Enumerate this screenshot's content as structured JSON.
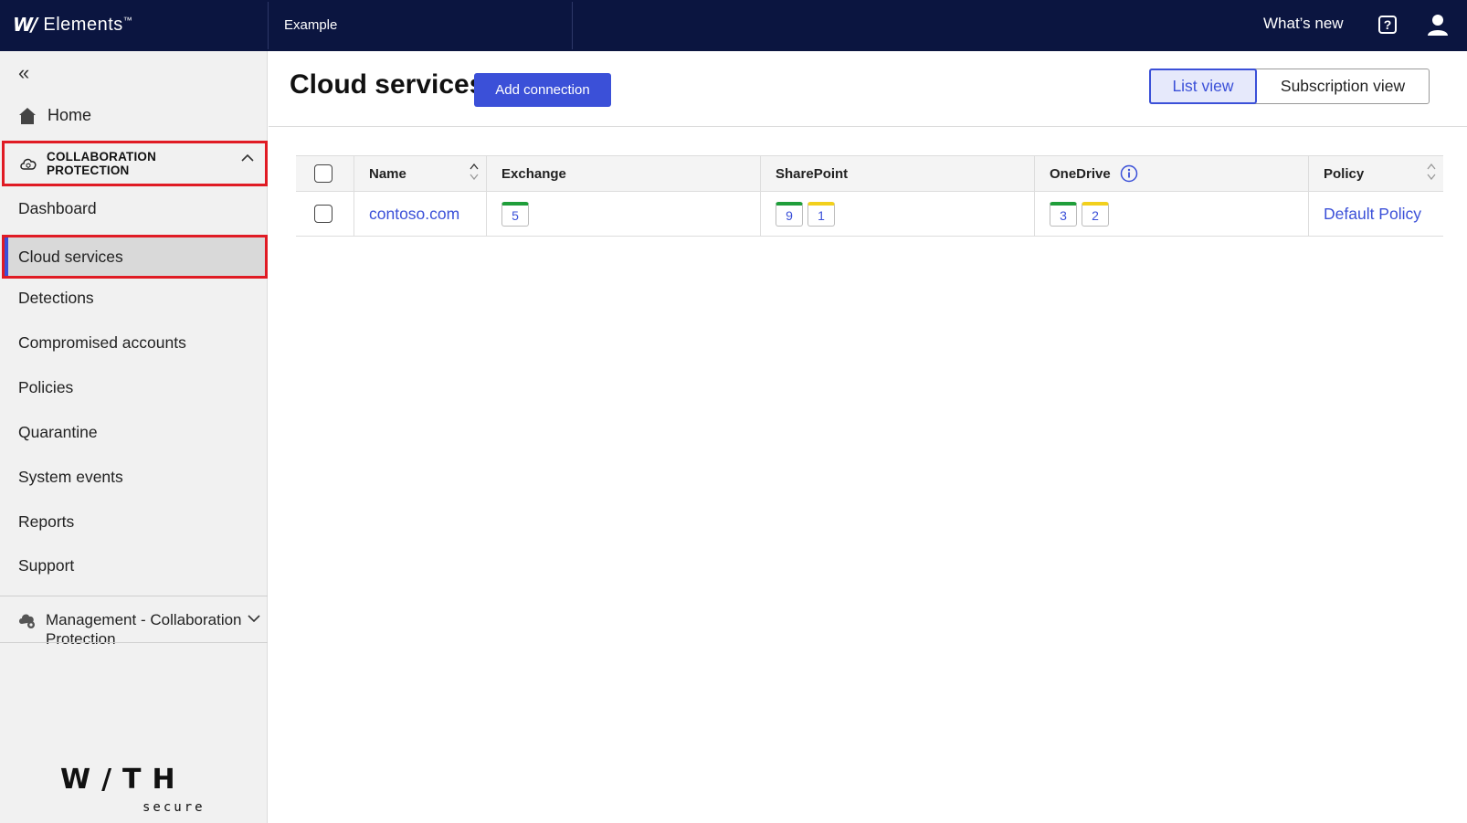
{
  "topbar": {
    "brand_glyph": "W/",
    "brand_name": "Elements",
    "brand_tm": "™",
    "org_name": "Example",
    "whats_new": "What’s new"
  },
  "sidebar": {
    "home": "Home",
    "section": "COLLABORATION PROTECTION",
    "items": [
      {
        "label": "Dashboard"
      },
      {
        "label": "Cloud services"
      },
      {
        "label": "Detections"
      },
      {
        "label": "Compromised accounts"
      },
      {
        "label": "Policies"
      },
      {
        "label": "Quarantine"
      },
      {
        "label": "System events"
      },
      {
        "label": "Reports"
      },
      {
        "label": "Support"
      }
    ],
    "management": "Management - Collaboration Protection",
    "footer_brand": "W/TH",
    "footer_sub": "secure"
  },
  "main": {
    "title": "Cloud services",
    "add_button": "Add connection",
    "views": [
      "List view",
      "Subscription view"
    ],
    "table": {
      "columns": [
        "Name",
        "Exchange",
        "SharePoint",
        "OneDrive",
        "Policy"
      ],
      "rows": [
        {
          "name": "contoso.com",
          "exchange": [
            {
              "value": "5",
              "status": "green"
            }
          ],
          "sharepoint": [
            {
              "value": "9",
              "status": "green"
            },
            {
              "value": "1",
              "status": "yellow"
            }
          ],
          "onedrive": [
            {
              "value": "3",
              "status": "green"
            },
            {
              "value": "2",
              "status": "yellow"
            }
          ],
          "policy": "Default Policy"
        }
      ]
    }
  },
  "colors": {
    "topbar": "#0b1540",
    "accent": "#3b50d8",
    "highlight": "#e01b24",
    "status_green": "#1f9e3a",
    "status_yellow": "#f2d01c"
  }
}
